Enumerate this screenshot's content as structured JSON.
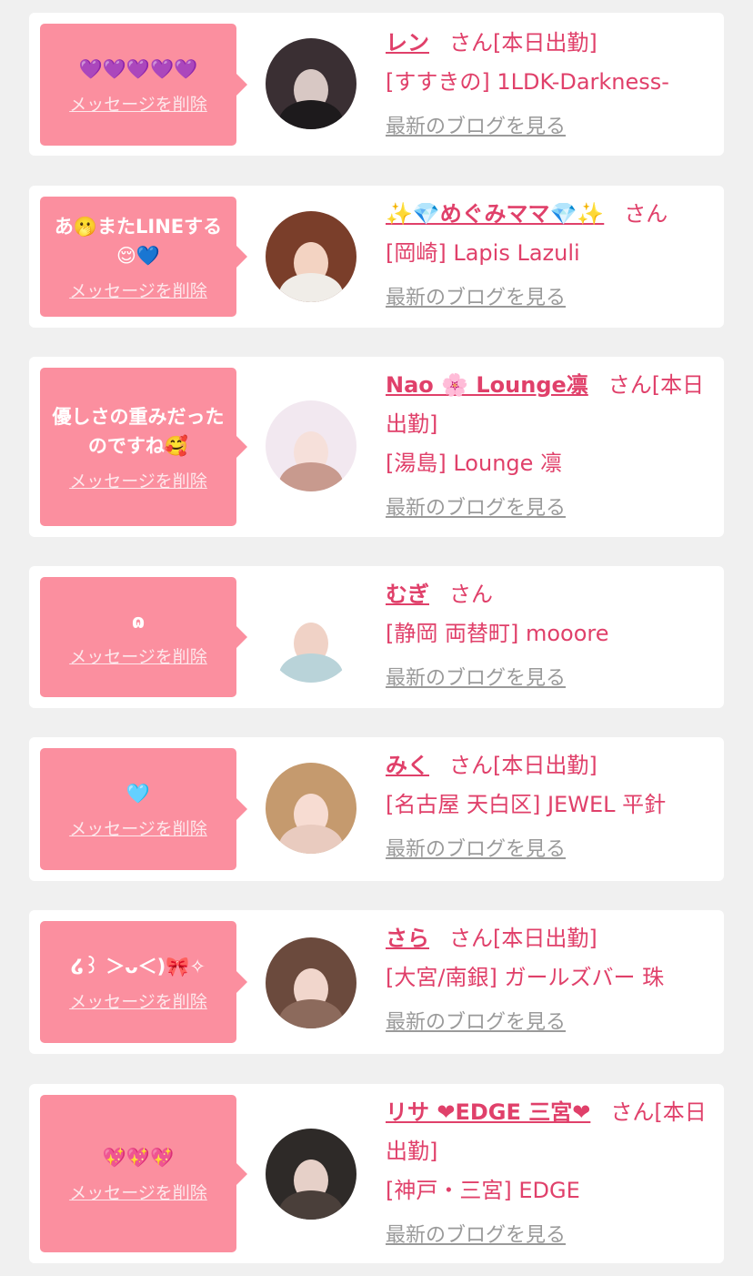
{
  "colors": {
    "background": "#f0f0f0",
    "card": "#ffffff",
    "bubble": "#fb8f9f",
    "accent": "#e0406a",
    "link_muted": "#9a9a9a"
  },
  "items": [
    {
      "message": "💜💜💜💜💜",
      "delete_label": "メッセージを削除",
      "name": "レン",
      "san": "さん[本日出勤]",
      "shop": "[すすきの] 1LDK-Darkness-",
      "blog_link": "最新のブログを見る"
    },
    {
      "message": "あ🫢またLINEする😌💙",
      "delete_label": "メッセージを削除",
      "name": "✨💎めぐみママ💎✨",
      "san": "さん",
      "shop": "[岡崎] Lapis Lazuli",
      "blog_link": "最新のブログを見る"
    },
    {
      "message": "優しさの重みだったのですね🥰",
      "delete_label": "メッセージを削除",
      "name": "Nao 🌸 Lounge凛",
      "san": "さん[本日出勤]",
      "shop": "[湯島] Lounge 凛",
      "blog_link": "最新のブログを見る"
    },
    {
      "message": "ɷ",
      "delete_label": "メッセージを削除",
      "name": "むぎ",
      "san": "さん",
      "shop": "[静岡 両替町] mooore",
      "blog_link": "最新のブログを見る"
    },
    {
      "message": "🩵",
      "delete_label": "メッセージを削除",
      "name": "みく",
      "san": "さん[本日出勤]",
      "shop": "[名古屋 天白区] JEWEL 平針",
      "blog_link": "最新のブログを見る"
    },
    {
      "message": "໒꒱ ＞ᴗ＜)🎀✧",
      "delete_label": "メッセージを削除",
      "name": "さら",
      "san": "さん[本日出勤]",
      "shop": "[大宮/南銀] ガールズバー 珠",
      "blog_link": "最新のブログを見る"
    },
    {
      "message": "💖💖💖",
      "delete_label": "メッセージを削除",
      "name": "リサ ❤EDGE 三宮❤",
      "san": "さん[本日出勤]",
      "shop": "[神戸・三宮] EDGE",
      "blog_link": "最新のブログを見る"
    }
  ]
}
